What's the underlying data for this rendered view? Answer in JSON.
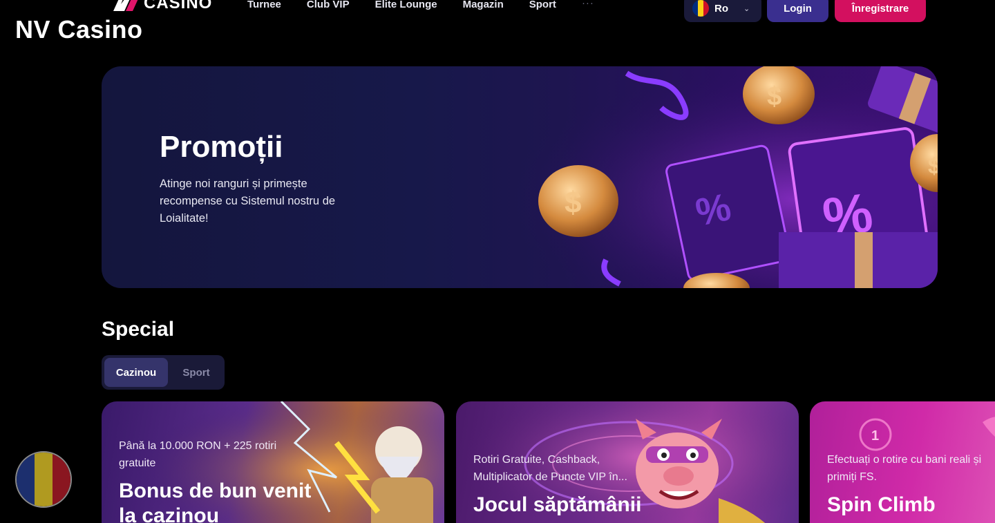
{
  "header": {
    "logo_text": "CASINO",
    "nav": [
      "Turnee",
      "Club VIP",
      "Elite Lounge",
      "Magazin",
      "Sport"
    ],
    "more": "···",
    "language": "Ro",
    "login": "Login",
    "register": "Înregistrare"
  },
  "site_caption": "NV Casino",
  "hero": {
    "title": "Promoții",
    "text": "Atinge noi ranguri și primește recompense cu Sistemul nostru de Loialitate!"
  },
  "special": {
    "title": "Special",
    "tabs": [
      {
        "label": "Cazinou",
        "active": true
      },
      {
        "label": "Sport",
        "active": false
      }
    ],
    "cards": [
      {
        "subtitle": "Până la 10.000 RON + 225 rotiri gratuite",
        "title": "Bonus de bun venit la cazinou"
      },
      {
        "subtitle": "Rotiri Gratuite, Cashback, Multiplicator de Puncte VIP în...",
        "title": "Jocul săptămânii"
      },
      {
        "subtitle": "Efectuați o rotire cu bani reali și primiți FS.",
        "title": "Spin Climb"
      }
    ]
  },
  "colors": {
    "flag_blue": "#002b7f",
    "flag_yellow": "#fcd116",
    "flag_red": "#ce1126",
    "register": "#d3105f",
    "login": "#3a2f8f"
  }
}
